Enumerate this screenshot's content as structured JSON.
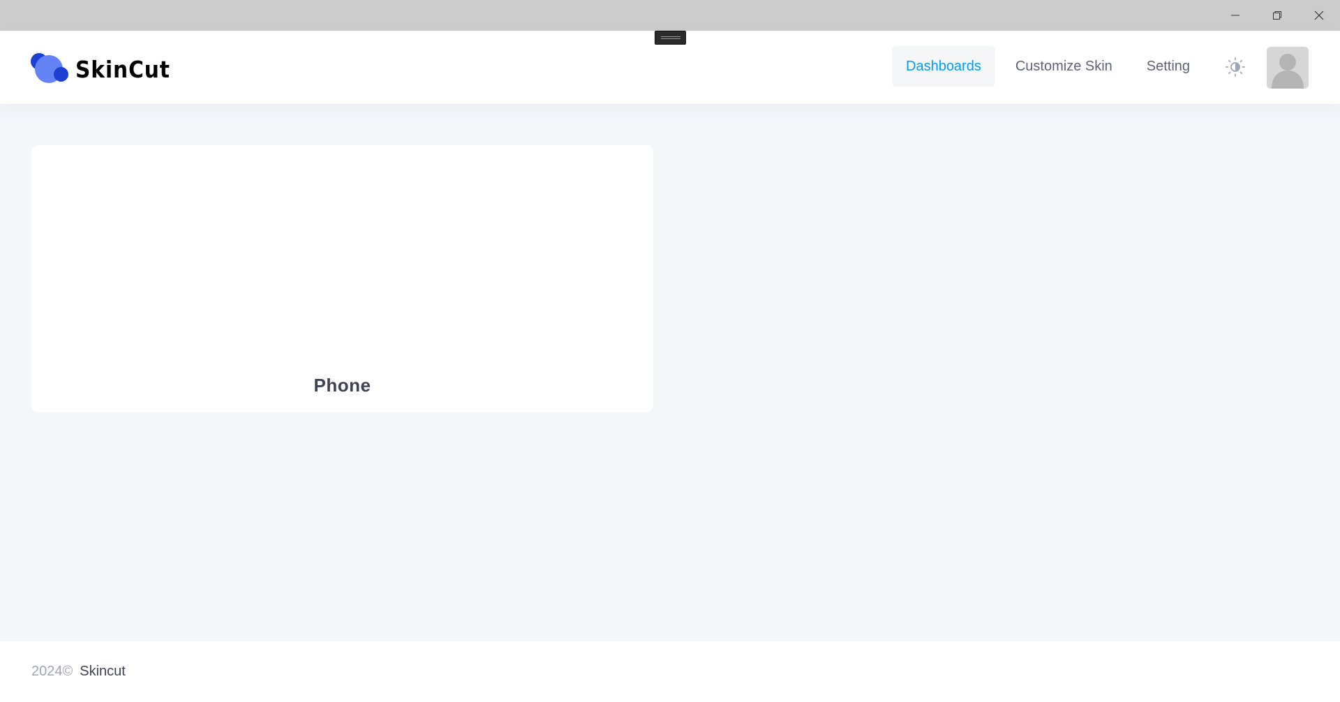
{
  "window": {
    "controls": {
      "minimize_icon": "minimize-icon",
      "restore_icon": "restore-icon",
      "close_icon": "close-icon"
    }
  },
  "header": {
    "brand_name": "SkinCut",
    "colors": {
      "logo_dark": "#1e3fd6",
      "logo_light": "#6383f5",
      "accent": "#009ef7"
    },
    "nav": [
      {
        "label": "Dashboards",
        "active": true
      },
      {
        "label": "Customize Skin",
        "active": false
      },
      {
        "label": "Setting",
        "active": false
      }
    ],
    "theme_icon": "sun-icon",
    "avatar_icon": "user-avatar-icon"
  },
  "main": {
    "cards": [
      {
        "title": "Phone"
      }
    ]
  },
  "footer": {
    "year": "2024©",
    "name": "Skincut"
  }
}
